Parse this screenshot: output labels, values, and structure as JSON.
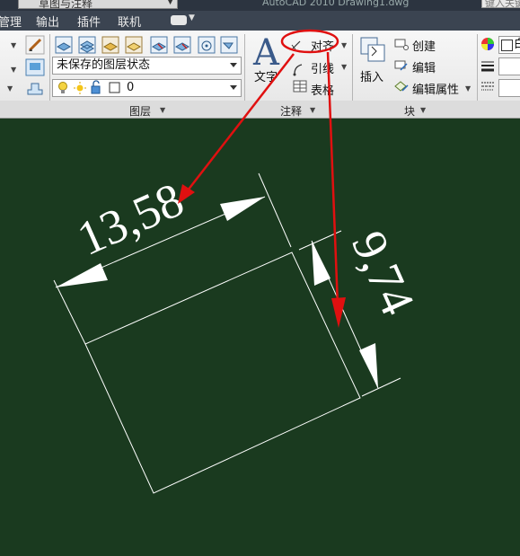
{
  "titlebar": {
    "workspace": "草图与注释",
    "app_title": "AutoCAD 2010   Drawing1.dwg",
    "search_placeholder": "键入关键"
  },
  "menu_tabs": [
    "管理",
    "输出",
    "插件",
    "联机"
  ],
  "layers_panel": {
    "layer_state": "未保存的图层状态",
    "current_layer": "0",
    "title": "图层"
  },
  "annotation_panel": {
    "text_label": "文字",
    "big_letter": "A",
    "align_label": "对齐",
    "leader_label": "引线",
    "table_label": "表格",
    "title": "注释"
  },
  "block_panel": {
    "insert_label": "插入",
    "create_label": "创建",
    "edit_label": "编辑",
    "edit_attr_label": "编辑属性",
    "title": "块"
  },
  "properties_panel": {
    "by_layer_fragment": "白"
  },
  "drawing": {
    "dim_horizontal": "13,58",
    "dim_vertical": "9,74"
  },
  "colors": {
    "canvas": "#1a3a1f",
    "annotation_red": "#e01010",
    "line_white": "#ffffff"
  }
}
